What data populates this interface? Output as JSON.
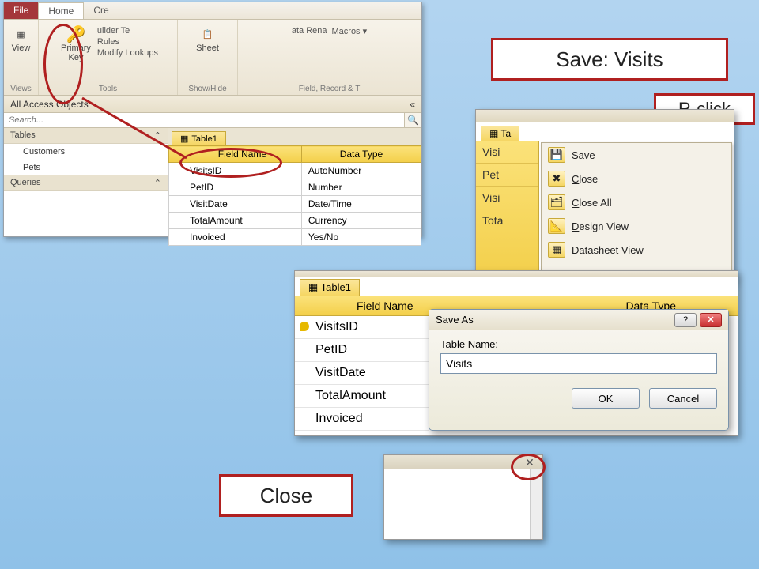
{
  "callouts": {
    "primary_key": "Primary Key",
    "save_visits": "Save: Visits",
    "r_click": "R-click",
    "close": "Close"
  },
  "ribbon": {
    "tabs": {
      "file": "File",
      "home": "Home",
      "create": "Cre"
    },
    "view": "View",
    "primary_key": "Primary\nKey",
    "builder": "uilder Te",
    "rules": "Rules",
    "modify_lookups": "Modify Lookups",
    "sheet": "Sheet",
    "data_rena": "ata Rena",
    "macros": "Macros ▾",
    "groups": {
      "views": "Views",
      "tools": "Tools",
      "showhide": "Show/Hide",
      "field": "Field, Record & T"
    }
  },
  "nav": {
    "header": "All Access Objects",
    "search_placeholder": "Search...",
    "cat_tables": "Tables",
    "cat_queries": "Queries",
    "items": [
      "Customers",
      "Pets"
    ]
  },
  "table": {
    "tab": "Table1",
    "headers": {
      "field": "Field Name",
      "type": "Data Type"
    },
    "rows": [
      {
        "field": "VisitsID",
        "type": "AutoNumber"
      },
      {
        "field": "PetID",
        "type": "Number"
      },
      {
        "field": "VisitDate",
        "type": "Date/Time"
      },
      {
        "field": "TotalAmount",
        "type": "Currency"
      },
      {
        "field": "Invoiced",
        "type": "Yes/No"
      }
    ]
  },
  "context": {
    "tab_partial": "Ta",
    "left_rows": [
      "Visi",
      "Pet",
      "Visi",
      "Tota"
    ],
    "items": [
      {
        "k": "S",
        "rest": "ave"
      },
      {
        "k": "C",
        "rest": "lose"
      },
      {
        "k": "C",
        "rest": "lose All"
      },
      {
        "k": "D",
        "rest": "esign View"
      },
      {
        "k": "",
        "rest": "Datasheet View"
      }
    ]
  },
  "panel3": {
    "tab": "Table1",
    "head_field": "Field Name",
    "head_type": "Data Type",
    "rows": [
      "VisitsID",
      "PetID",
      "VisitDate",
      "TotalAmount",
      "Invoiced"
    ]
  },
  "dialog": {
    "title": "Save As",
    "label": "Table Name:",
    "value": "Visits",
    "ok": "OK",
    "cancel": "Cancel"
  }
}
